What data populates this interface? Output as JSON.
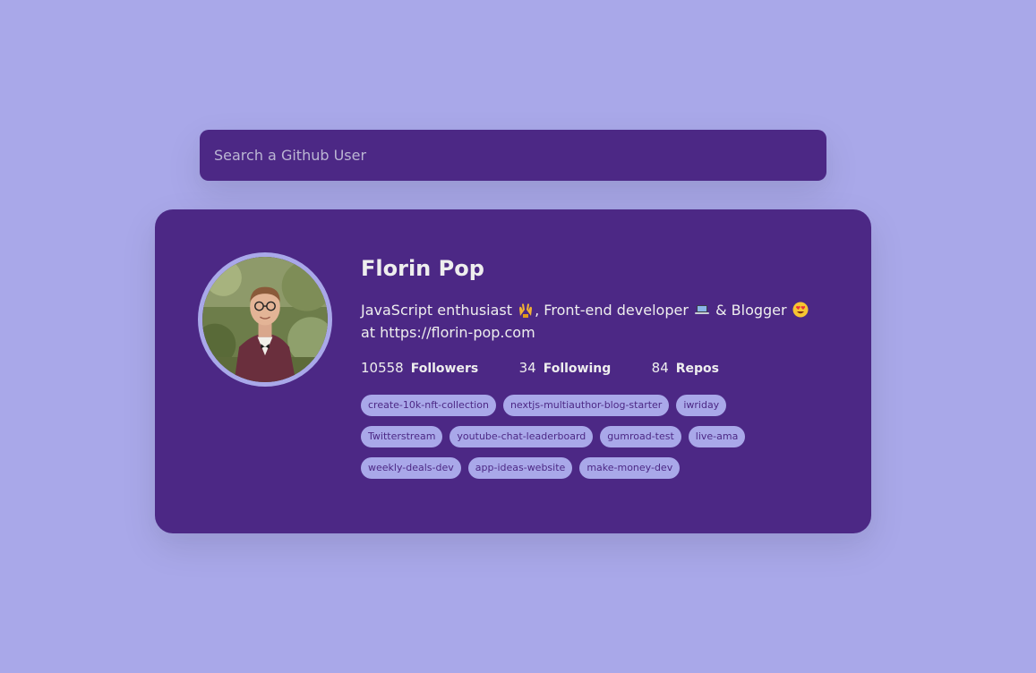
{
  "search": {
    "placeholder": "Search a Github User"
  },
  "user": {
    "name": "Florin Pop",
    "bio_parts": {
      "part1": "JavaScript enthusiast",
      "part2": ", Front-end developer",
      "part3": "& Blogger",
      "part4": "at https://florin-pop.com"
    },
    "emojis": [
      "raising-hands-icon",
      "laptop-icon",
      "heart-eyes-icon"
    ],
    "stats": {
      "followers_count": "10558",
      "followers_label": "Followers",
      "following_count": "34",
      "following_label": "Following",
      "repos_count": "84",
      "repos_label": "Repos"
    },
    "repos": [
      "create-10k-nft-collection",
      "nextjs-multiauthor-blog-starter",
      "iwriday",
      "Twitterstream",
      "youtube-chat-leaderboard",
      "gumroad-test",
      "live-ama",
      "weekly-deals-dev",
      "app-ideas-website",
      "make-money-dev"
    ]
  },
  "colors": {
    "background": "#a9a8e9",
    "card": "#4c2885",
    "text": "#eeeeee",
    "chip_bg": "#a9a8e9",
    "chip_text": "#4c2885"
  }
}
